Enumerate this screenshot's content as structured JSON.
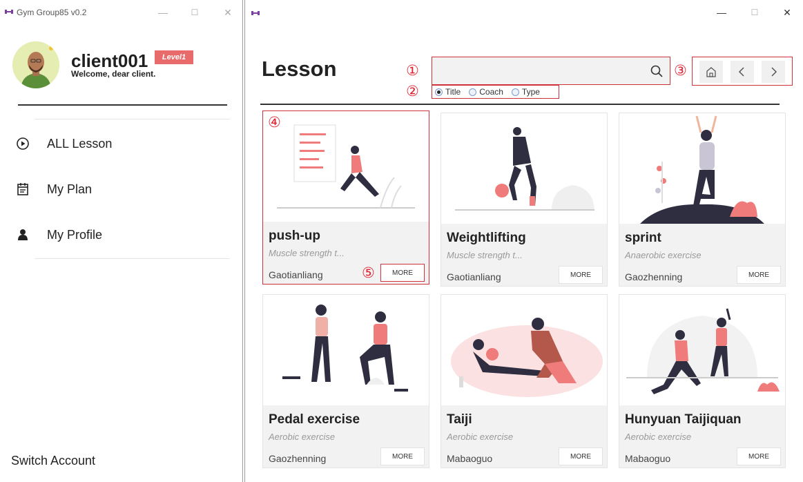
{
  "left_window": {
    "title": "Gym Group85 v0.2",
    "controls": [
      "—",
      "☐",
      "✕"
    ],
    "user": {
      "name": "client001",
      "level": "Level1",
      "welcome": "Welcome, dear client."
    },
    "nav": [
      {
        "label": "ALL Lesson",
        "icon": "play-circle-icon"
      },
      {
        "label": "My Plan",
        "icon": "calendar-icon"
      },
      {
        "label": "My Profile",
        "icon": "person-icon"
      }
    ],
    "switch_account": "Switch Account"
  },
  "right_window": {
    "controls": [
      "—",
      "☐",
      "✕"
    ],
    "page_title": "Lesson",
    "search": {
      "value": "",
      "placeholder": ""
    },
    "filters": [
      {
        "label": "Title",
        "checked": true
      },
      {
        "label": "Coach",
        "checked": false
      },
      {
        "label": "Type",
        "checked": false
      }
    ],
    "annotations": [
      "①",
      "②",
      "③",
      "④",
      "⑤"
    ],
    "lessons": [
      {
        "title": "push-up",
        "subtitle": "Muscle strength t...",
        "coach": "Gaotianliang",
        "more": "MORE"
      },
      {
        "title": "Weightlifting",
        "subtitle": "Muscle strength t...",
        "coach": "Gaotianliang",
        "more": "MORE"
      },
      {
        "title": "sprint",
        "subtitle": "Anaerobic exercise",
        "coach": "Gaozhenning",
        "more": "MORE"
      },
      {
        "title": "Pedal exercise",
        "subtitle": "Aerobic exercise",
        "coach": "Gaozhenning",
        "more": "MORE"
      },
      {
        "title": "Taiji",
        "subtitle": "Aerobic exercise",
        "coach": "Mabaoguo",
        "more": "MORE"
      },
      {
        "title": "Hunyuan Taijiquan",
        "subtitle": "Aerobic exercise",
        "coach": "Mabaoguo",
        "more": "MORE"
      }
    ]
  },
  "colors": {
    "accent": "#e96a6a",
    "annotation_red": "#e0212f",
    "logo_purple": "#7b3fa0",
    "card_bg": "#f2f2f2"
  }
}
